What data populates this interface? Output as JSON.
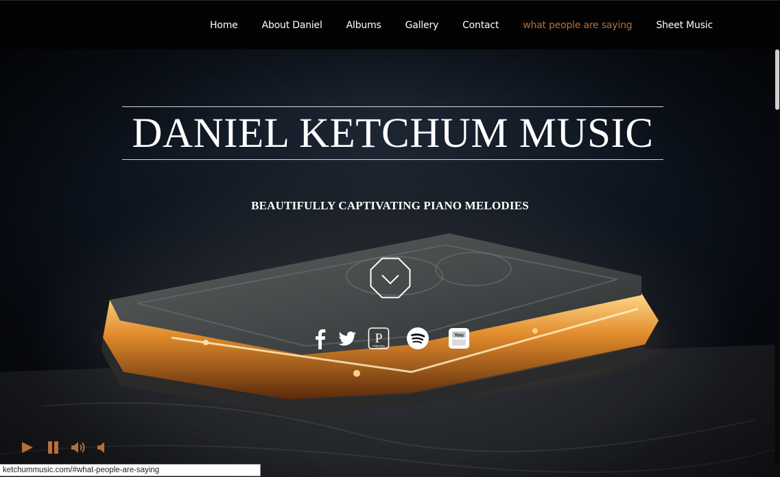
{
  "nav": {
    "items": [
      {
        "label": "Home",
        "active": false
      },
      {
        "label": "About Daniel",
        "active": false
      },
      {
        "label": "Albums",
        "active": false
      },
      {
        "label": "Gallery",
        "active": false
      },
      {
        "label": "Contact",
        "active": false
      },
      {
        "label": "what people are saying",
        "active": true
      },
      {
        "label": "Sheet Music",
        "active": false
      }
    ],
    "active_color": "#b96e34"
  },
  "hero": {
    "title": "DANIEL KETCHUM MUSIC",
    "tagline": "BEAUTIFULLY CAPTIVATING PIANO MELODIES",
    "scroll_icon": "chevron-down-octagon-icon"
  },
  "social": {
    "icons": [
      "facebook-icon",
      "twitter-icon",
      "pandora-icon",
      "spotify-icon",
      "youtube-icon"
    ],
    "pandora_letter": "P",
    "pandora_caption": "PANDORA",
    "youtube_text": "You"
  },
  "player": {
    "icons": [
      "play-icon",
      "pause-icon",
      "volume-up-icon",
      "volume-mute-icon"
    ],
    "accent_color": "#b96e34"
  },
  "status_bar": {
    "url": "ketchummusic.com/#what-people-are-saying"
  }
}
